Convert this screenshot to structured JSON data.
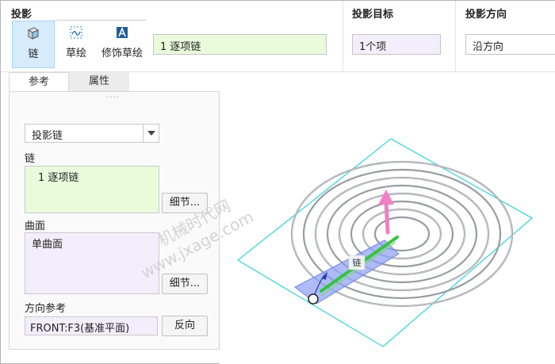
{
  "ribbon": {
    "projection_title": "投影",
    "target_title": "投影目标",
    "direction_title": "投影方向",
    "tools": [
      {
        "label": "链"
      },
      {
        "label": "草绘"
      },
      {
        "label": "修饰草绘"
      }
    ],
    "chain_field_value": "1 逐项链",
    "target_field_value": "1个项",
    "direction_field_value": "沿方向"
  },
  "tabs": [
    {
      "label": "参考",
      "active": true
    },
    {
      "label": "属性",
      "active": false
    }
  ],
  "panel": {
    "grip": "····",
    "projection_type_selected": "投影链",
    "chain_label": "链",
    "chain_items": [
      "1 逐项链"
    ],
    "chain_details_button": "细节...",
    "surface_label": "曲面",
    "surface_items": [
      "单曲面"
    ],
    "surface_details_button": "细节...",
    "direction_ref_label": "方向参考",
    "direction_ref_value": "FRONT:F3(基准平面)",
    "reverse_button": "反向"
  },
  "viewport": {
    "chain_tag": "链"
  },
  "watermark": {
    "line1": "机械时代网",
    "line2": "www.jxage.com"
  },
  "colors": {
    "active_tool_bg": "#d7ecfb",
    "chain_field_bg": "#eafbdc",
    "collector_bg": "#f3eefc",
    "plane_outline": "#3fd6da",
    "chain_green": "#35c43d",
    "direction_arrow": "#f07fc4",
    "surface_highlight": "#8b9ef5",
    "spiral": "#9a9ca3"
  }
}
